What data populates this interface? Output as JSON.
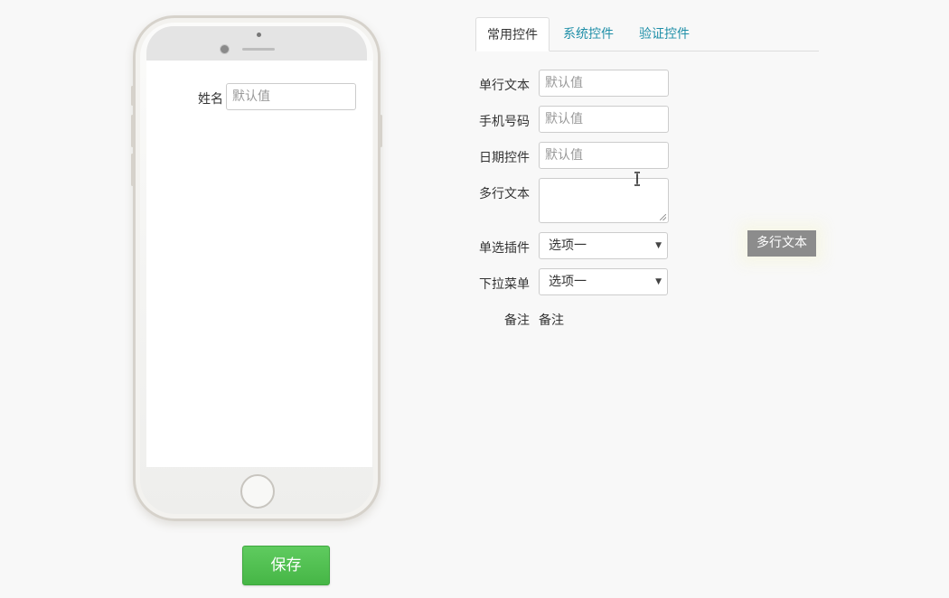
{
  "preview": {
    "field_label": "姓名",
    "field_placeholder": "默认值"
  },
  "actions": {
    "save_label": "保存"
  },
  "tabs": [
    {
      "label": "常用控件",
      "active": true
    },
    {
      "label": "系统控件",
      "active": false
    },
    {
      "label": "验证控件",
      "active": false
    }
  ],
  "form": {
    "single_line": {
      "label": "单行文本",
      "placeholder": "默认值"
    },
    "phone": {
      "label": "手机号码",
      "placeholder": "默认值"
    },
    "date": {
      "label": "日期控件",
      "placeholder": "默认值"
    },
    "multi_line": {
      "label": "多行文本",
      "value": ""
    },
    "radio": {
      "label": "单选插件",
      "selected": "选项一"
    },
    "dropdown": {
      "label": "下拉菜单",
      "selected": "选项一"
    },
    "remark": {
      "label": "备注",
      "value": "备注"
    }
  },
  "tooltip": {
    "text": "多行文本"
  },
  "colors": {
    "accent_tab": "#1f8fa8",
    "save_green": "#4cbb4c",
    "tooltip_bg": "#8c8c8c"
  }
}
